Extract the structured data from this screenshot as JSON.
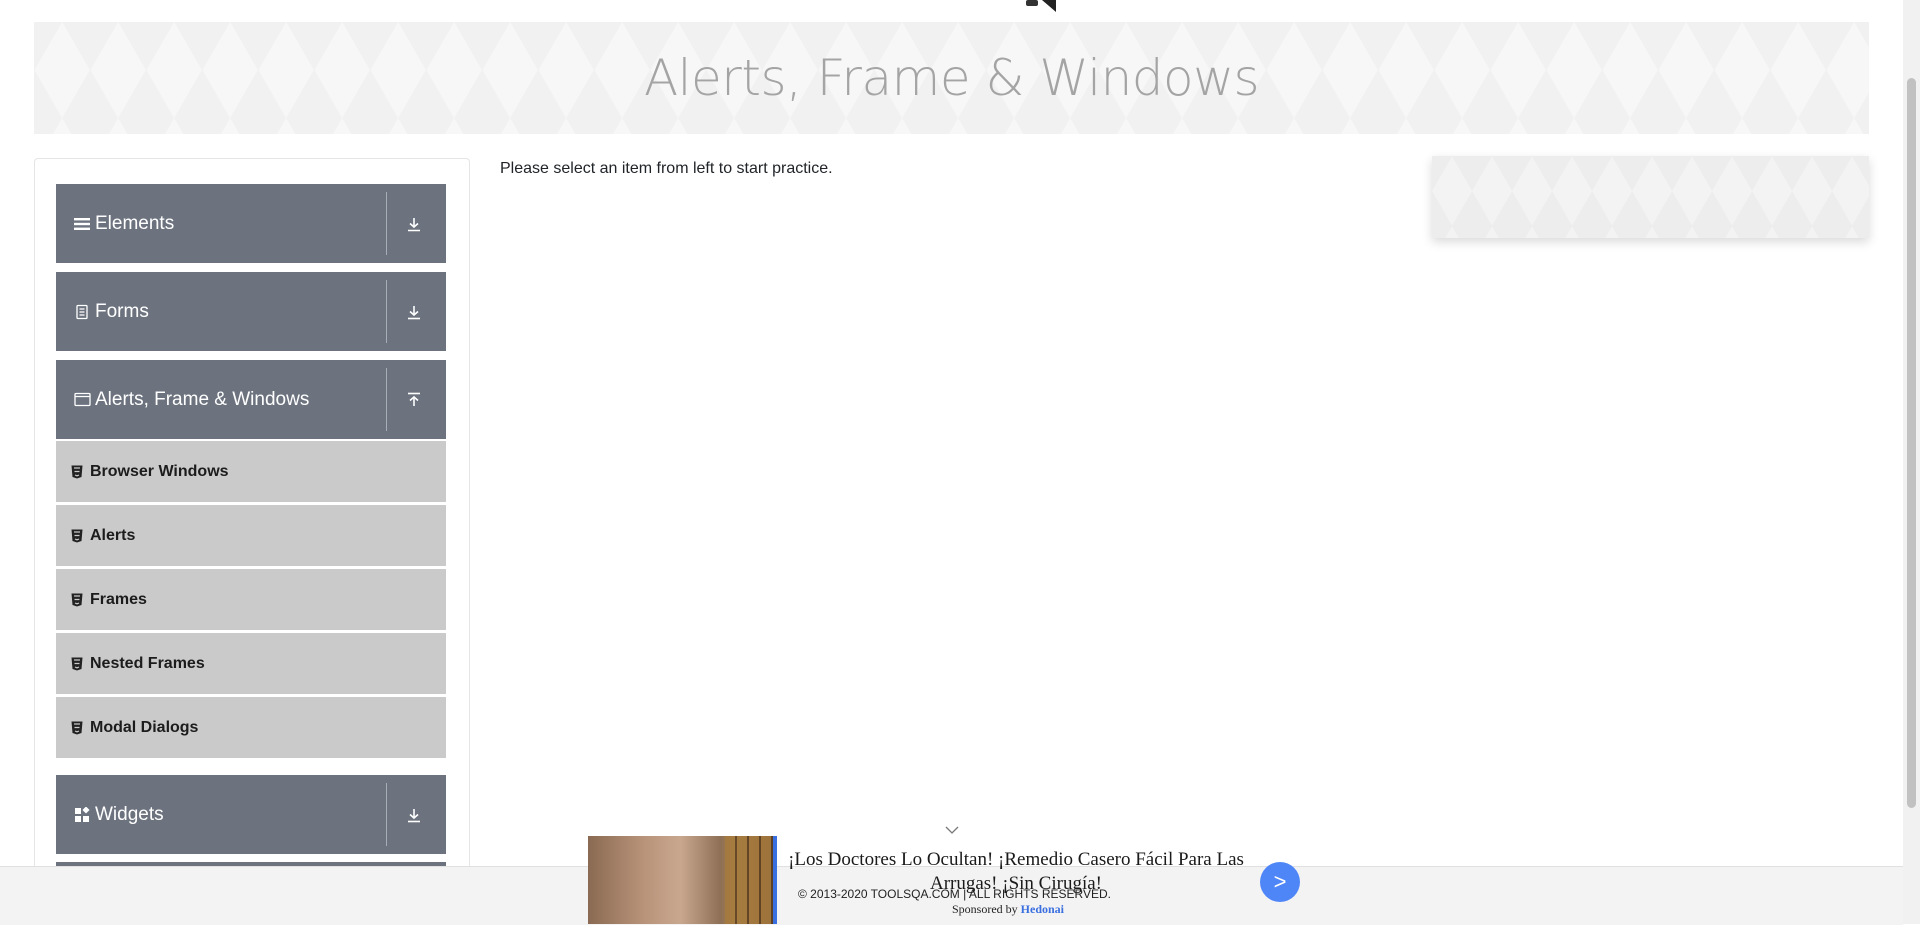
{
  "page": {
    "title": "Alerts, Frame & Windows",
    "instruction": "Please select an item from left to start practice."
  },
  "sidebar": {
    "groups": [
      {
        "label": "Elements",
        "icon": "menu-bars-icon",
        "state": "collapsed"
      },
      {
        "label": "Forms",
        "icon": "form-document-icon",
        "state": "collapsed"
      },
      {
        "label": "Alerts, Frame & Windows",
        "icon": "window-icon",
        "state": "expanded",
        "items": [
          {
            "label": "Browser Windows"
          },
          {
            "label": "Alerts"
          },
          {
            "label": "Frames"
          },
          {
            "label": "Nested Frames"
          },
          {
            "label": "Modal Dialogs"
          }
        ]
      },
      {
        "label": "Widgets",
        "icon": "widgets-grid-icon",
        "state": "collapsed"
      }
    ]
  },
  "footer": {
    "copyright": "© 2013-2020 TOOLSQA.COM | ALL RIGHTS RESERVED."
  },
  "ad": {
    "headline": "¡Los Doctores Lo Ocultan! ¡Remedio Casero Fácil Para Las Arrugas! ¡Sin Cirugía!",
    "sponsor_prefix": "Sponsored by",
    "sponsor_brand": "Hedonai",
    "go_label": ">"
  },
  "colors": {
    "group_header_bg": "#6c737f",
    "sub_item_bg": "#cacaca",
    "title_color": "#a4a4a4",
    "ad_button": "#4f86f7"
  }
}
